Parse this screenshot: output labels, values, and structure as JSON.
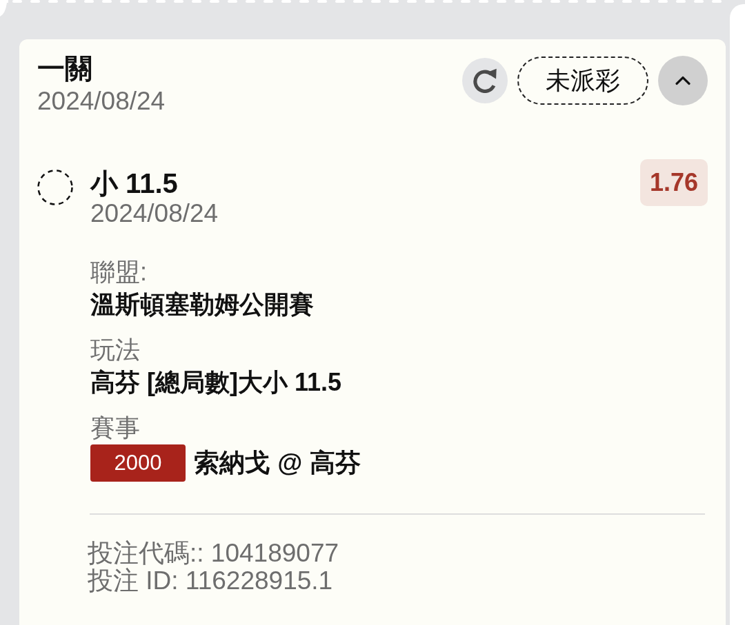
{
  "bet": {
    "title": "一關",
    "date": "2024/08/24",
    "status": "未派彩",
    "expanded": true
  },
  "selections": [
    {
      "settled": false,
      "name": "小 11.5",
      "date": "2024/08/24",
      "odds": "1.76",
      "details": [
        {
          "label": "聯盟:",
          "value": "溫斯頓塞勒姆公開賽"
        },
        {
          "label": "玩法",
          "value": "高芬 [總局數]大小 11.5"
        },
        {
          "label": "賽事",
          "tag": "2000",
          "value": "索納戈 @ 高芬"
        }
      ]
    }
  ],
  "footer": {
    "bet_code": "投注代碼:: 104189077",
    "bet_id": "投注 ID: 116228915.1"
  }
}
